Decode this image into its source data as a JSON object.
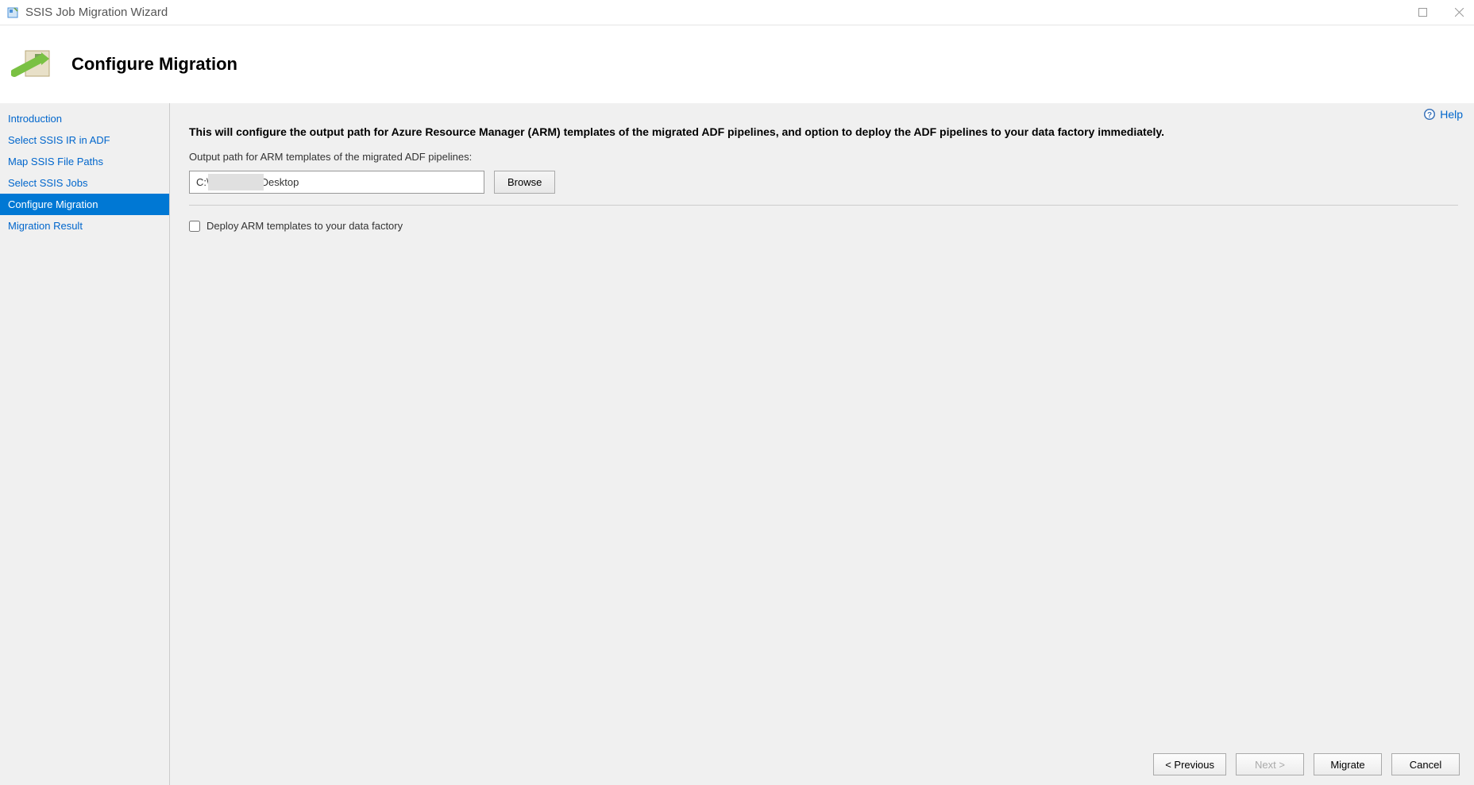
{
  "titlebar": {
    "title": "SSIS Job Migration Wizard"
  },
  "header": {
    "title": "Configure Migration"
  },
  "sidebar": {
    "items": [
      {
        "label": "Introduction",
        "active": false
      },
      {
        "label": "Select SSIS IR in ADF",
        "active": false
      },
      {
        "label": "Map SSIS File Paths",
        "active": false
      },
      {
        "label": "Select SSIS Jobs",
        "active": false
      },
      {
        "label": "Configure Migration",
        "active": true
      },
      {
        "label": "Migration Result",
        "active": false
      }
    ]
  },
  "content": {
    "help_label": "Help",
    "instruction": "This will configure the output path for Azure Resource Manager (ARM) templates of the migrated ADF pipelines, and option to deploy the ADF pipelines to your data factory immediately.",
    "output_label": "Output path for ARM templates of the migrated ADF pipelines:",
    "output_value": "C:\\                 \\Desktop",
    "browse_label": "Browse",
    "deploy_checkbox_label": "Deploy ARM templates to your data factory",
    "deploy_checked": false
  },
  "footer": {
    "previous": "< Previous",
    "next": "Next >",
    "migrate": "Migrate",
    "cancel": "Cancel"
  }
}
